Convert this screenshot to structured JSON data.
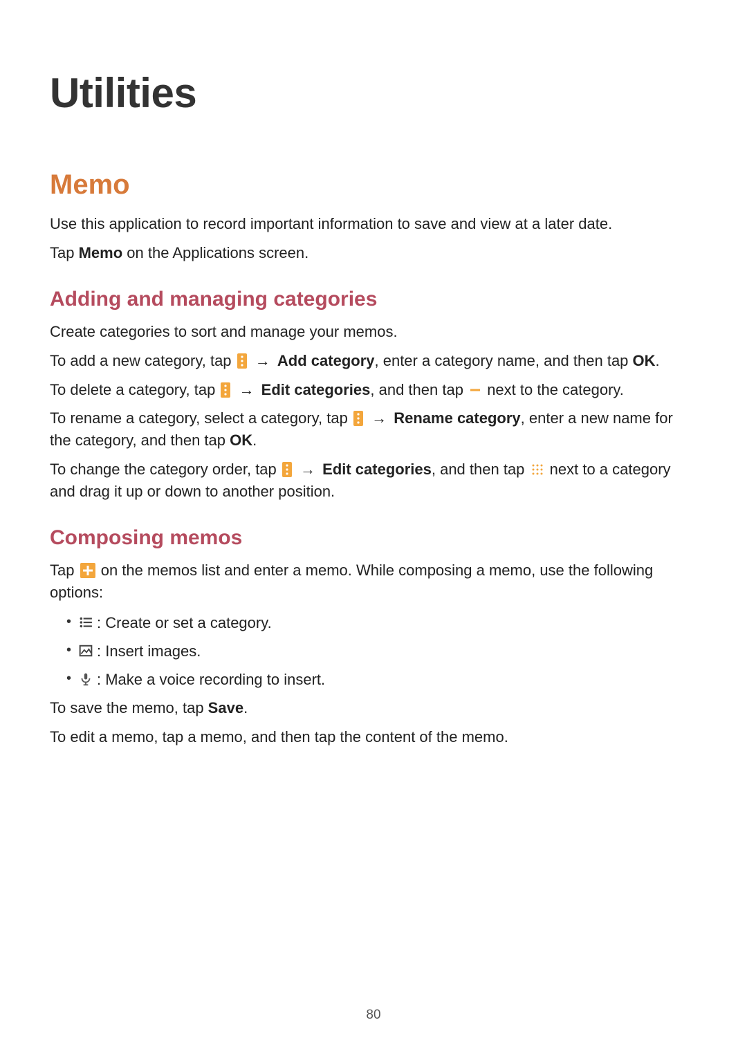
{
  "page_number": "80",
  "h1": "Utilities",
  "section_memo": {
    "title": "Memo",
    "intro1": "Use this application to record important information to save and view at a later date.",
    "intro2_prefix": "Tap ",
    "intro2_bold": "Memo",
    "intro2_suffix": " on the Applications screen."
  },
  "sub_categories": {
    "title": "Adding and managing categories",
    "p1": "Create categories to sort and manage your memos.",
    "p2": {
      "a": "To add a new category, tap ",
      "arrow": "→",
      "b_bold": "Add category",
      "c": ", enter a category name, and then tap ",
      "d_bold": "OK",
      "e": "."
    },
    "p3": {
      "a": "To delete a category, tap ",
      "arrow": "→",
      "b_bold": "Edit categories",
      "c": ", and then tap ",
      "d": " next to the category."
    },
    "p4": {
      "a": "To rename a category, select a category, tap ",
      "arrow": "→",
      "b_bold": "Rename category",
      "c": ", enter a new name for the category, and then tap ",
      "d_bold": "OK",
      "e": "."
    },
    "p5": {
      "a": "To change the category order, tap ",
      "arrow": "→",
      "b_bold": "Edit categories",
      "c": ", and then tap ",
      "d": " next to a category and drag it up or down to another position."
    }
  },
  "sub_composing": {
    "title": "Composing memos",
    "p1": {
      "a": "Tap ",
      "b": " on the memos list and enter a memo. While composing a memo, use the following options:"
    },
    "bullets": [
      ": Create or set a category.",
      ": Insert images.",
      ": Make a voice recording to insert."
    ],
    "p2": {
      "a": "To save the memo, tap ",
      "b_bold": "Save",
      "c": "."
    },
    "p3": "To edit a memo, tap a memo, and then tap the content of the memo."
  }
}
